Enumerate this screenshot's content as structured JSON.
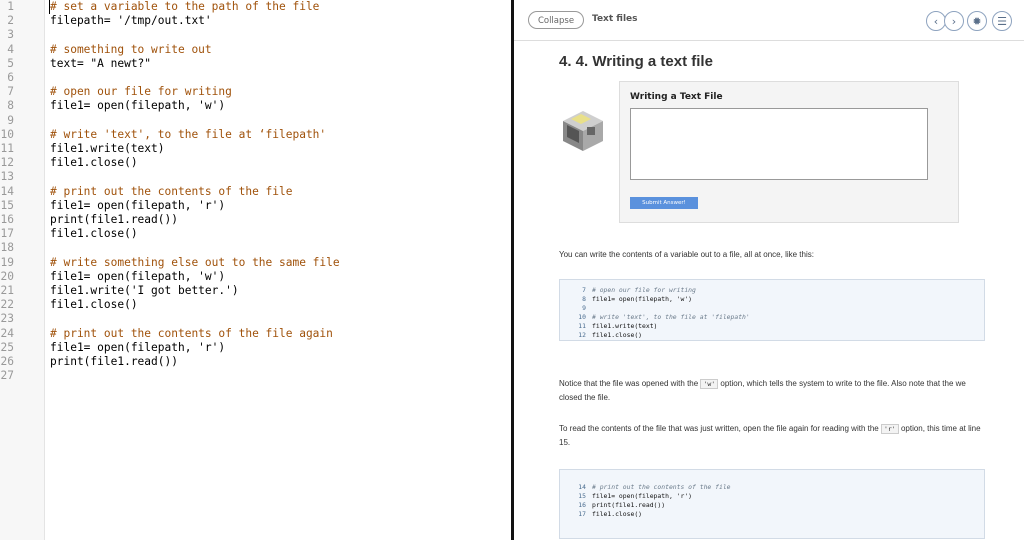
{
  "editor": {
    "lines": [
      {
        "n": "1",
        "t": "# set a variable to the path of the file",
        "c": true
      },
      {
        "n": "2",
        "t": "filepath= '/tmp/out.txt'",
        "c": false
      },
      {
        "n": "3",
        "t": "",
        "c": false
      },
      {
        "n": "4",
        "t": "# something to write out",
        "c": true
      },
      {
        "n": "5",
        "t": "text= \"A newt?\"",
        "c": false
      },
      {
        "n": "6",
        "t": "",
        "c": false
      },
      {
        "n": "7",
        "t": "# open our file for writing",
        "c": true
      },
      {
        "n": "8",
        "t": "file1= open(filepath, 'w')",
        "c": false
      },
      {
        "n": "9",
        "t": "",
        "c": false
      },
      {
        "n": "10",
        "t": "# write 'text', to the file at ‘filepath'",
        "c": true
      },
      {
        "n": "11",
        "t": "file1.write(text)",
        "c": false
      },
      {
        "n": "12",
        "t": "file1.close()",
        "c": false
      },
      {
        "n": "13",
        "t": "",
        "c": false
      },
      {
        "n": "14",
        "t": "# print out the contents of the file",
        "c": true
      },
      {
        "n": "15",
        "t": "file1= open(filepath, 'r')",
        "c": false
      },
      {
        "n": "16",
        "t": "print(file1.read())",
        "c": false
      },
      {
        "n": "17",
        "t": "file1.close()",
        "c": false
      },
      {
        "n": "18",
        "t": "",
        "c": false
      },
      {
        "n": "19",
        "t": "# write something else out to the same file",
        "c": true
      },
      {
        "n": "20",
        "t": "file1= open(filepath, 'w')",
        "c": false
      },
      {
        "n": "21",
        "t": "file1.write('I got better.')",
        "c": false
      },
      {
        "n": "22",
        "t": "file1.close()",
        "c": false
      },
      {
        "n": "23",
        "t": "",
        "c": false
      },
      {
        "n": "24",
        "t": "# print out the contents of the file again",
        "c": true
      },
      {
        "n": "25",
        "t": "file1= open(filepath, 'r')",
        "c": false
      },
      {
        "n": "26",
        "t": "print(file1.read())",
        "c": false
      },
      {
        "n": "27",
        "t": "",
        "c": false
      }
    ]
  },
  "panel": {
    "collapse_label": "Collapse",
    "breadcrumb": "Text files",
    "nav": {
      "prev_icon": "chevron-left-icon",
      "next_icon": "chevron-right-icon",
      "settings_icon": "gear-icon",
      "menu_icon": "menu-icon"
    },
    "nav_glyphs": {
      "prev": "‹",
      "next": "›",
      "settings": "✹",
      "menu": "☰"
    },
    "title": "4. 4. Writing a text file",
    "question": {
      "title": "Writing a Text File",
      "answer_value": "",
      "submit_label": "Submit Answer!"
    },
    "para1": "You can write the contents of a variable out to a file, all at once, like this:",
    "codeblock1": [
      {
        "n": "7",
        "t": "# open our file for writing",
        "c": true
      },
      {
        "n": "8",
        "t": "file1= open(filepath, 'w')",
        "c": false
      },
      {
        "n": "9",
        "t": "",
        "c": false
      },
      {
        "n": "10",
        "t": "# write 'text', to the file at 'filepath'",
        "c": true
      },
      {
        "n": "11",
        "t": "file1.write(text)",
        "c": false
      },
      {
        "n": "12",
        "t": "file1.close()",
        "c": false
      }
    ],
    "para2": {
      "before": "Notice that the file was opened with the ",
      "code": "'w'",
      "after": " option, which tells the system to write to the file. Also note that the we closed the file."
    },
    "para3": {
      "before": "To read the contents of the file that was just written, open the file again for reading with the ",
      "code": "'r'",
      "after": " option, this time at line 15."
    },
    "codeblock2": [
      {
        "n": "14",
        "t": "# print out the contents of the file",
        "c": true
      },
      {
        "n": "15",
        "t": "file1= open(filepath, 'r')",
        "c": false
      },
      {
        "n": "16",
        "t": "print(file1.read())",
        "c": false
      },
      {
        "n": "17",
        "t": "file1.close()",
        "c": false
      }
    ]
  }
}
